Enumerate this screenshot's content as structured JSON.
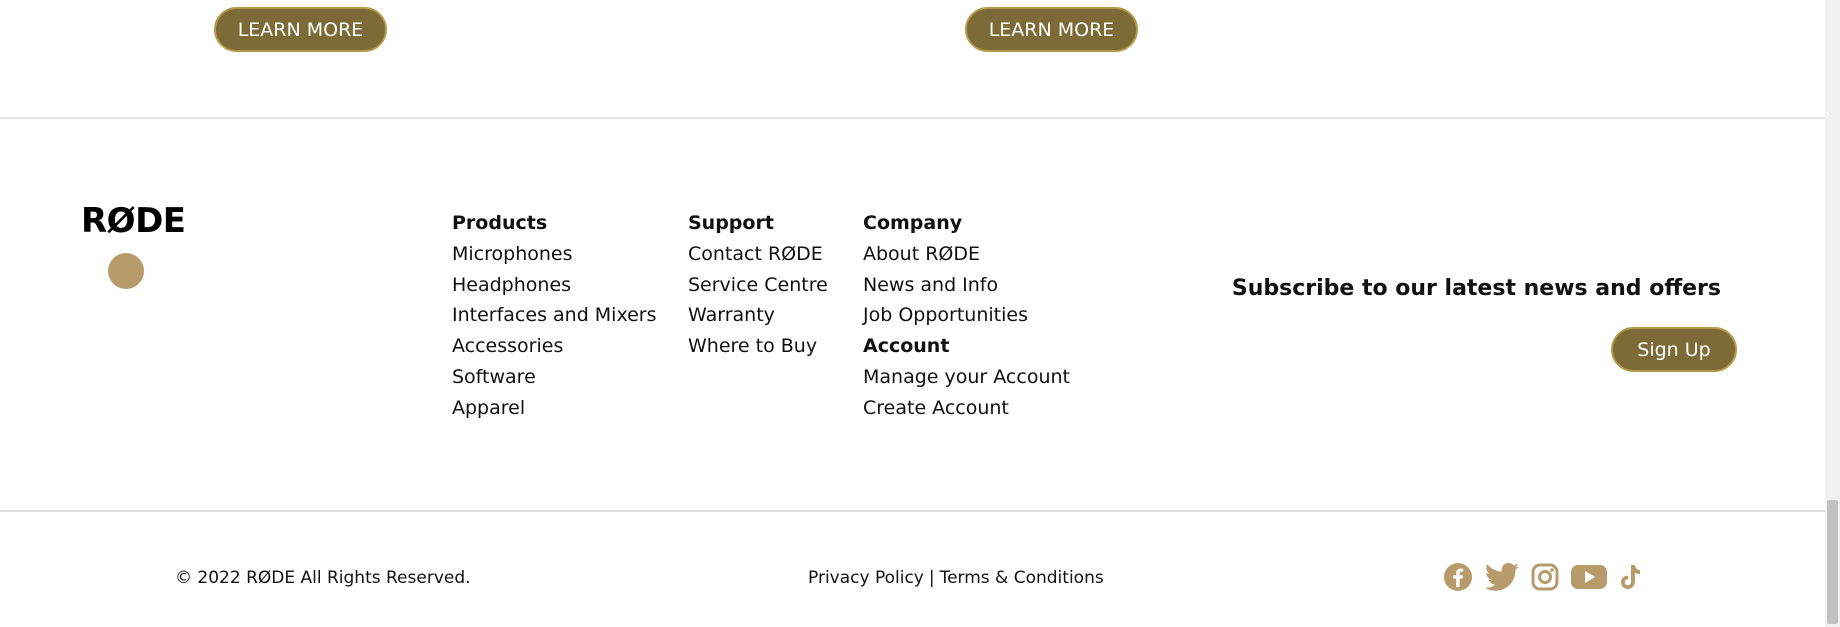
{
  "cards": {
    "learn_more_1": "LEARN MORE",
    "learn_more_2": "LEARN MORE"
  },
  "footer": {
    "logo_text": "RØDE",
    "columns": {
      "products": {
        "heading": "Products",
        "links": [
          "Microphones",
          "Headphones",
          "Interfaces and Mixers",
          "Accessories",
          "Software",
          "Apparel"
        ]
      },
      "support": {
        "heading": "Support",
        "links": [
          "Contact RØDE",
          "Service Centre",
          "Warranty",
          "Where to Buy"
        ]
      },
      "company": {
        "heading": "Company",
        "links": [
          "About RØDE",
          "News and Info",
          "Job Opportunities"
        ]
      },
      "account": {
        "heading": "Account",
        "links": [
          "Manage your Account",
          "Create Account"
        ]
      }
    },
    "subscribe": {
      "title": "Subscribe to our latest news and offers",
      "button": "Sign Up"
    }
  },
  "bottom_bar": {
    "copyright": "© 2022 RØDE All Rights Reserved.",
    "privacy": "Privacy Policy",
    "separator": "|",
    "terms": "Terms & Conditions",
    "socials": [
      "facebook-icon",
      "twitter-icon",
      "instagram-icon",
      "youtube-icon",
      "tiktok-icon"
    ]
  },
  "colors": {
    "button_bg": "#7c6a37",
    "button_border": "#b49a4a",
    "social_icon": "#b79b6b",
    "logo_dot": "#b79b6b"
  }
}
